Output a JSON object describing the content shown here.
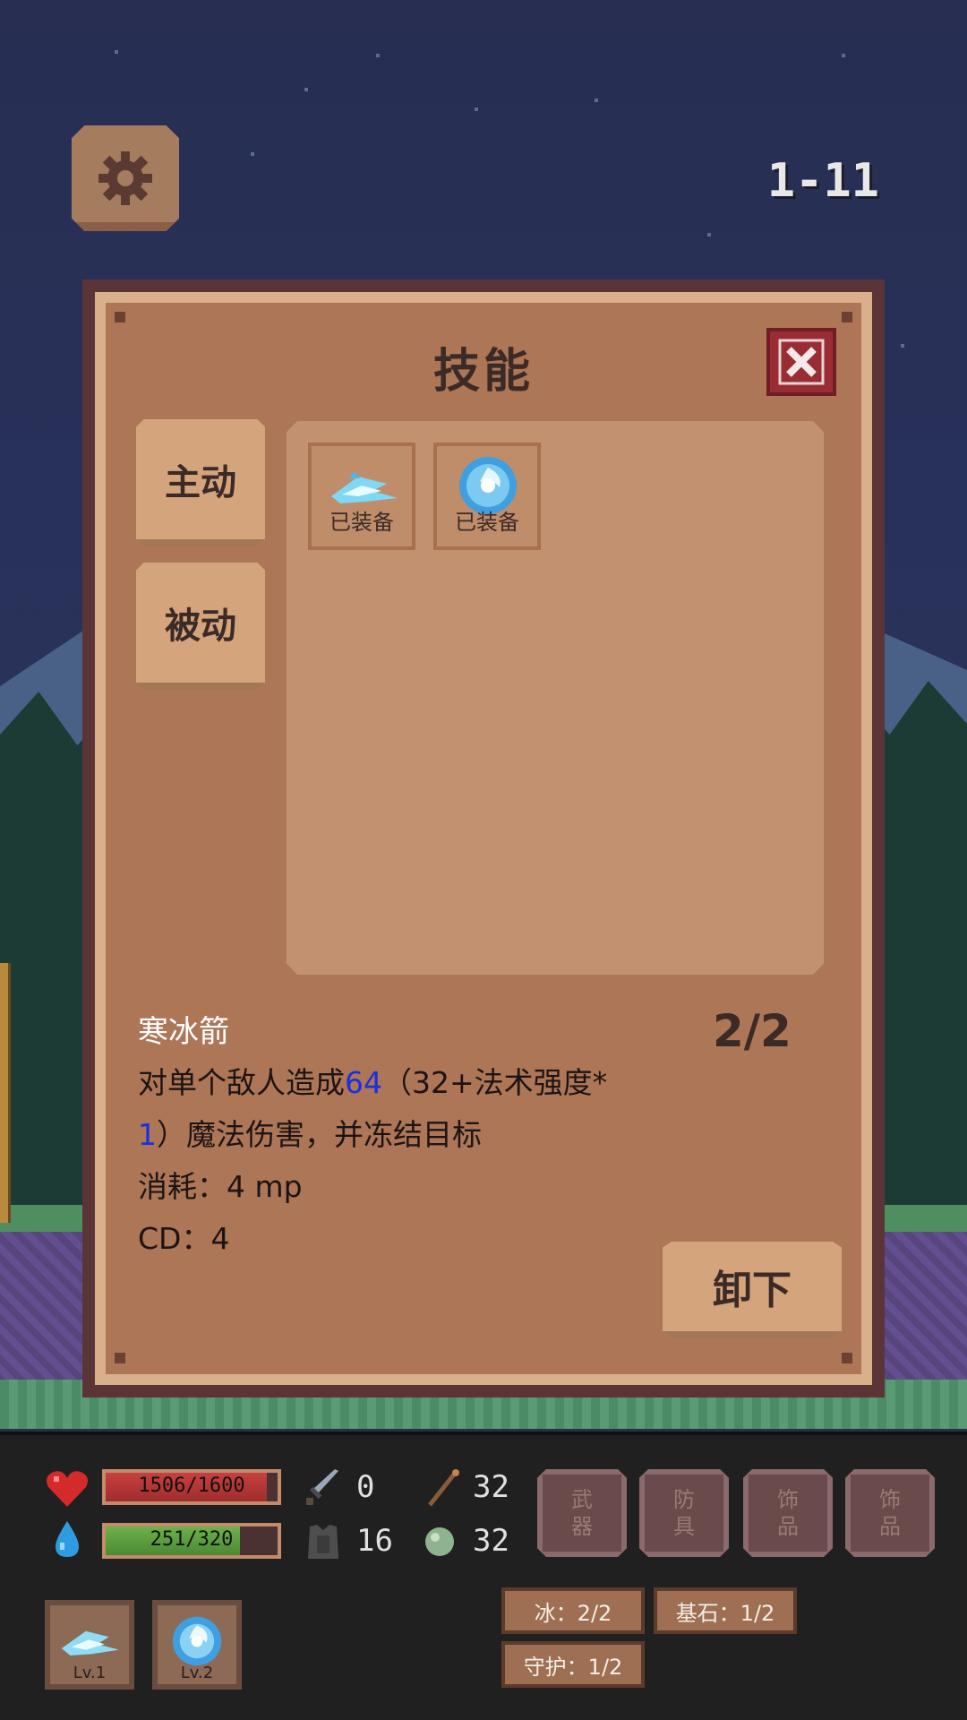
{
  "hud": {
    "level": "1-11"
  },
  "panel": {
    "title": "技能",
    "tabs": {
      "active": "主动",
      "passive": "被动"
    },
    "slots": [
      {
        "icon": "ice-arrow-icon",
        "label": "已装备"
      },
      {
        "icon": "frost-orb-icon",
        "label": "已装备"
      }
    ],
    "skill": {
      "name": "寒冰箭",
      "count": "2/2",
      "desc_part1": "对单个敌人造成",
      "desc_value": "64",
      "desc_part2": "（32+法术强度*",
      "desc_part3": "1",
      "desc_part4": "）魔法伤害，并冻结目标",
      "cost": "消耗：4 mp",
      "cd": "CD：4"
    },
    "unequip_label": "卸下"
  },
  "stats": {
    "hp": {
      "text": "1506/1600",
      "fraction": 0.94,
      "color": "#c84040"
    },
    "mp": {
      "text": "251/320",
      "fraction": 0.78,
      "color": "#6fb04a"
    },
    "attack": "0",
    "magic": "32",
    "defense": "16",
    "resist": "32"
  },
  "equipment": [
    {
      "label": "武器"
    },
    {
      "label": "防具"
    },
    {
      "label": "饰品"
    },
    {
      "label": "饰品"
    }
  ],
  "tags": {
    "ice": "冰：2/2",
    "cornerstone": "基石：1/2",
    "guard": "守护：1/2"
  },
  "quick_skills": [
    {
      "icon": "ice-arrow-icon",
      "label": "Lv.1"
    },
    {
      "icon": "frost-orb-icon",
      "label": "Lv.2"
    }
  ]
}
